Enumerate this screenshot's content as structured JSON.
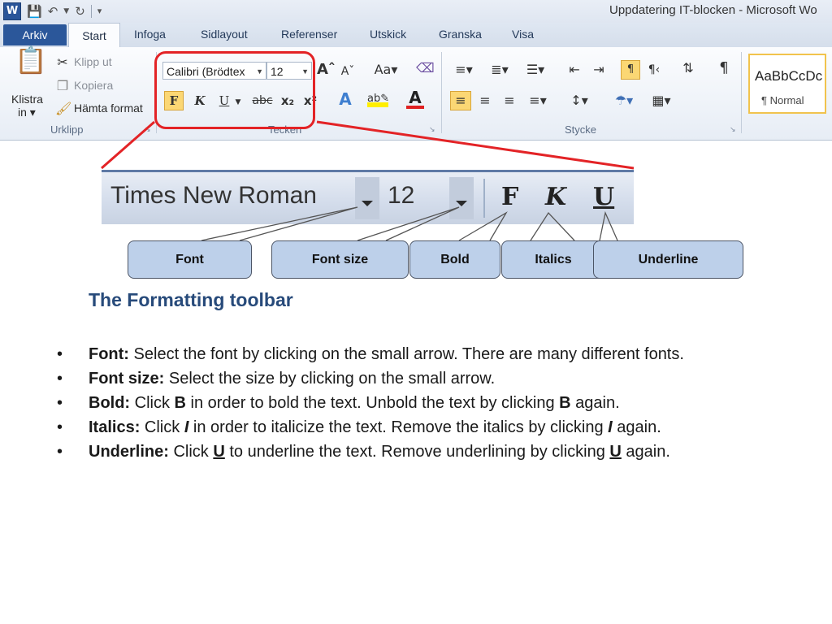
{
  "window": {
    "app_icon": "W",
    "title": "Uppdatering IT-blocken  -  Microsoft Wo"
  },
  "tabs": [
    {
      "label": "Arkiv"
    },
    {
      "label": "Start"
    },
    {
      "label": "Infoga"
    },
    {
      "label": "Sidlayout"
    },
    {
      "label": "Referenser"
    },
    {
      "label": "Utskick"
    },
    {
      "label": "Granska"
    },
    {
      "label": "Visa"
    }
  ],
  "ribbon": {
    "clipboard": {
      "paste_label": "Klistra\nin",
      "paste_line1": "Klistra",
      "paste_line2": "in ▾",
      "cut": "Klipp ut",
      "copy": "Kopiera",
      "format_painter": "Hämta format",
      "group": "Urklipp"
    },
    "font": {
      "font_name": "Calibri (Brödtex",
      "font_size": "12",
      "group": "Tecken",
      "bold": "F",
      "italic": "K",
      "underline": "U",
      "strike": "abc",
      "subscript": "x₂",
      "superscript": "x²"
    },
    "paragraph": {
      "group": "Stycke"
    },
    "styles": {
      "sample": "AaBbCcDc",
      "normal": "¶ Normal"
    }
  },
  "zoom_toolbar": {
    "font_name": "Times New Roman",
    "font_size": "12",
    "bold": "F",
    "italic": "K",
    "underline": "U"
  },
  "callouts": {
    "font": "Font",
    "font_size": "Font size",
    "bold": "Bold",
    "italics": "Italics",
    "underline": "Underline"
  },
  "heading": "The Formatting toolbar",
  "bullets": {
    "font": {
      "term": "Font:",
      "text": " Select the font by clicking on the small arrow. There are many different fonts."
    },
    "size": {
      "term": "Font size:",
      "text": " Select the size by clicking on the small arrow."
    },
    "bold": {
      "term": "Bold:",
      "t1": " Click ",
      "k1": "B",
      "t2": " in order to bold the text. Unbold the text by clicking ",
      "k2": "B",
      "t3": " again."
    },
    "italics": {
      "term": "Italics:",
      "t1": " Click ",
      "k1": "I",
      "t2": " in order to italicize the text. Remove the italics by clicking ",
      "k2": "I",
      "t3": " again."
    },
    "underline": {
      "term": "Underline:",
      "t1": " Click ",
      "k1": "U",
      "t2": " to underline the text. Remove underlining by clicking ",
      "k2": "U",
      "t3": " again."
    }
  },
  "colors": {
    "highlight_red": "#e32326",
    "callout_fill": "#bdd0ea",
    "heading": "#274a7a",
    "file_tab": "#2b579a"
  }
}
